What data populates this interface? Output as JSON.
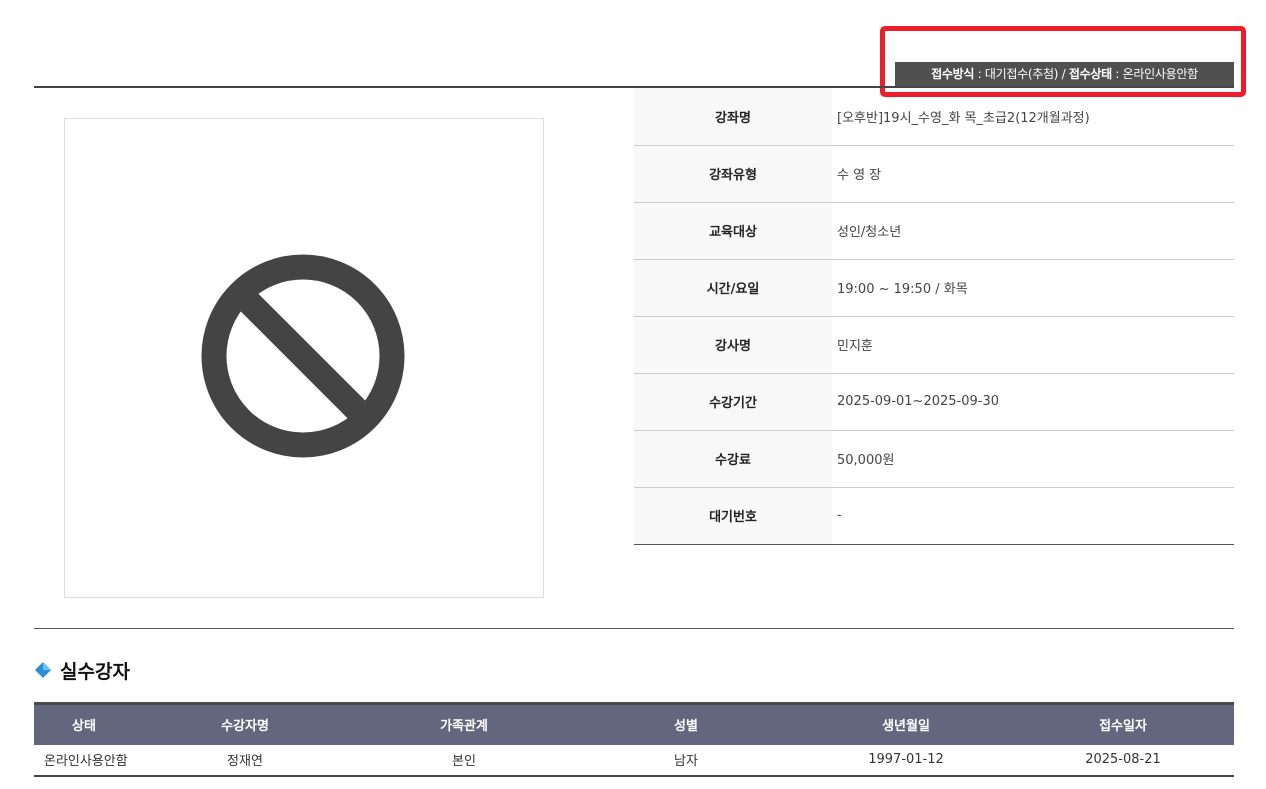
{
  "status": {
    "method_label": "접수방식",
    "method_value": "대기접수(추첨)",
    "separator": "/",
    "state_label": "접수상태",
    "state_value": "온라인사용안함",
    "colon": ":"
  },
  "image": {
    "icon": "prohibited-icon",
    "icon_color": "#444444"
  },
  "info": [
    {
      "label": "강좌명",
      "value": "[오후반]19시_수영_화 목_초급2(12개월과정)"
    },
    {
      "label": "강좌유형",
      "value": "수 영 장"
    },
    {
      "label": "교육대상",
      "value": "성인/청소년"
    },
    {
      "label": "시간/요일",
      "value": "19:00 ~ 19:50 / 화목"
    },
    {
      "label": "강사명",
      "value": "민지훈"
    },
    {
      "label": "수강기간",
      "value": "2025-09-01~2025-09-30"
    },
    {
      "label": "수강료",
      "value": "50,000원"
    },
    {
      "label": "대기번호",
      "value": "-"
    }
  ],
  "section": {
    "title": "실수강자",
    "icon": "diamond-icon"
  },
  "enrollees": {
    "headers": [
      "상태",
      "수강자명",
      "가족관계",
      "성별",
      "생년월일",
      "접수일자"
    ],
    "rows": [
      [
        "온라인사용안함",
        "정재연",
        "본인",
        "남자",
        "1997-01-12",
        "2025-08-21"
      ]
    ]
  },
  "colors": {
    "highlight": "#ee1d2b",
    "badge_bg": "#505050",
    "table_header_bg": "#63677e",
    "accent_diamond": "#2a8fd8"
  }
}
